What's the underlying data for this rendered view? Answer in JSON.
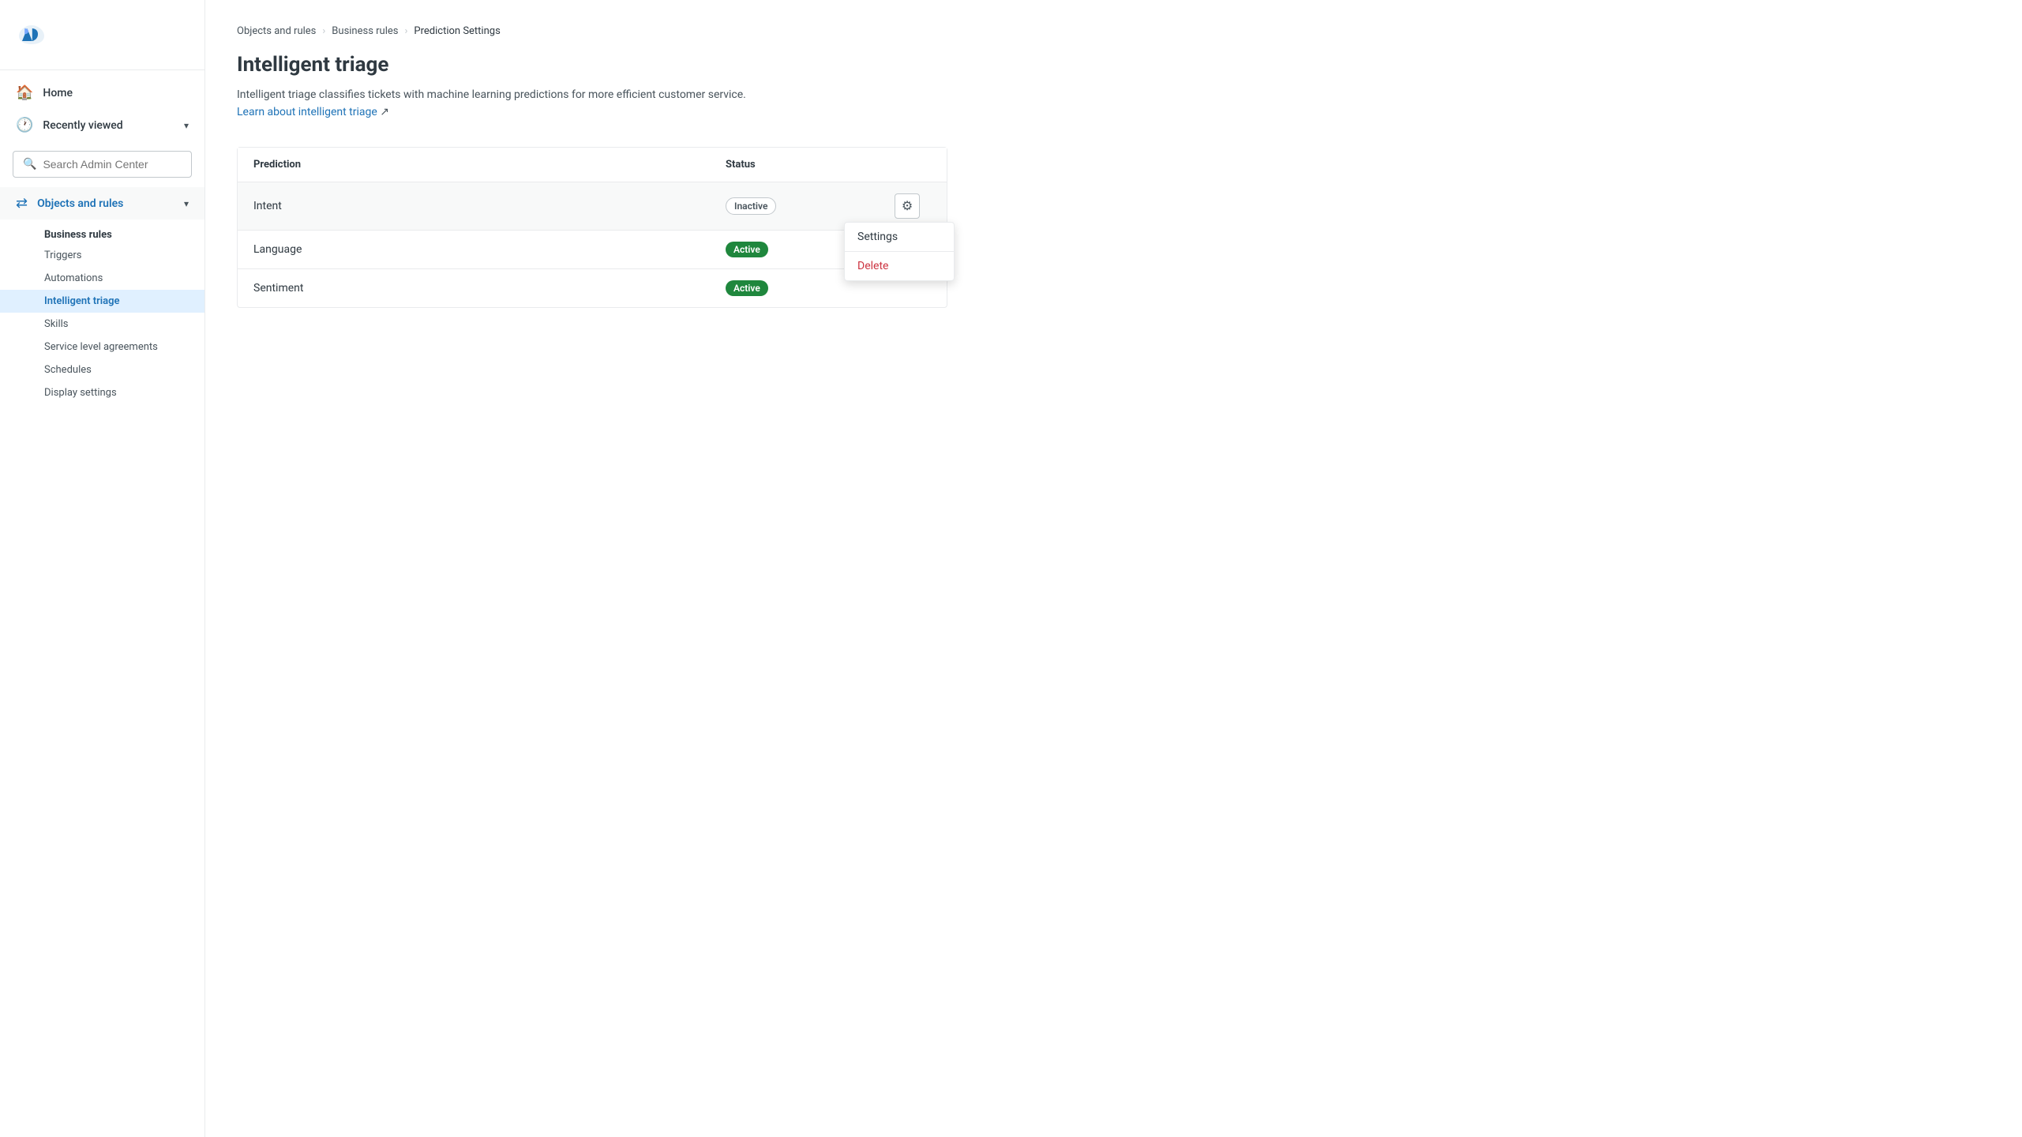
{
  "sidebar": {
    "logo_alt": "Zendesk Logo",
    "nav_items": [
      {
        "id": "home",
        "label": "Home",
        "icon": "🏠"
      }
    ],
    "recently_viewed": {
      "label": "Recently viewed",
      "icon": "🕐",
      "expanded": false
    },
    "search": {
      "placeholder": "Search Admin Center"
    },
    "objects_and_rules": {
      "label": "Objects and rules",
      "expanded": true,
      "categories": [
        {
          "label": "Business rules",
          "items": [
            {
              "id": "triggers",
              "label": "Triggers",
              "active": false
            },
            {
              "id": "automations",
              "label": "Automations",
              "active": false
            },
            {
              "id": "intelligent-triage",
              "label": "Intelligent triage",
              "active": true
            },
            {
              "id": "skills",
              "label": "Skills",
              "active": false
            },
            {
              "id": "sla",
              "label": "Service level agreements",
              "active": false
            },
            {
              "id": "schedules",
              "label": "Schedules",
              "active": false
            },
            {
              "id": "display-settings",
              "label": "Display settings",
              "active": false
            }
          ]
        }
      ]
    }
  },
  "breadcrumb": {
    "items": [
      {
        "label": "Objects and rules",
        "href": "#"
      },
      {
        "label": "Business rules",
        "href": "#"
      },
      {
        "label": "Prediction Settings",
        "current": true
      }
    ]
  },
  "page": {
    "title": "Intelligent triage",
    "description": "Intelligent triage classifies tickets with machine learning predictions for more efficient customer service.",
    "learn_more_text": "Learn about intelligent triage",
    "learn_more_href": "#"
  },
  "table": {
    "headers": {
      "prediction": "Prediction",
      "status": "Status"
    },
    "rows": [
      {
        "id": "intent",
        "prediction": "Intent",
        "status": "Inactive",
        "status_type": "inactive",
        "has_menu": true
      },
      {
        "id": "language",
        "prediction": "Language",
        "status": "Active",
        "status_type": "active",
        "has_menu": false
      },
      {
        "id": "sentiment",
        "prediction": "Sentiment",
        "status": "Active",
        "status_type": "active",
        "has_menu": false
      }
    ],
    "dropdown": {
      "settings_label": "Settings",
      "delete_label": "Delete"
    }
  }
}
